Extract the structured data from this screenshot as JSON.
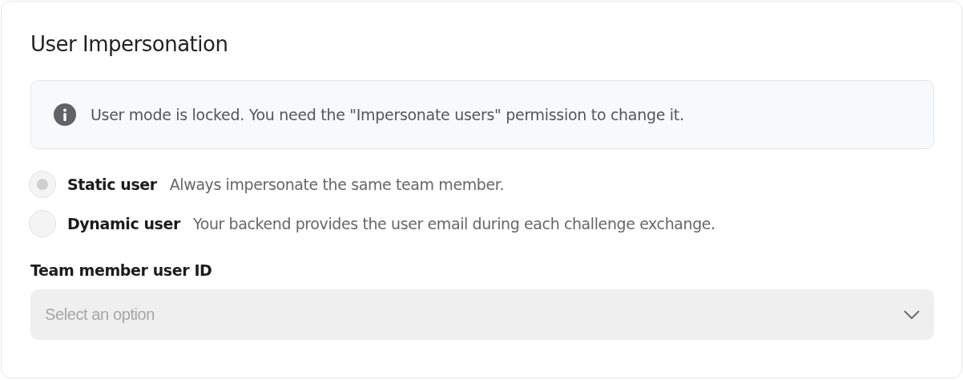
{
  "title": "User Impersonation",
  "notice": {
    "text": "User mode is locked. You need the \"Impersonate users\" permission to change it."
  },
  "user_mode": {
    "disabled": true,
    "options": [
      {
        "label": "Static user",
        "description": "Always impersonate the same team member.",
        "selected": true
      },
      {
        "label": "Dynamic user",
        "description": "Your backend provides the user email during each challenge exchange.",
        "selected": false
      }
    ]
  },
  "team_member_field": {
    "label": "Team member user ID",
    "placeholder": "Select an option",
    "disabled": true
  }
}
